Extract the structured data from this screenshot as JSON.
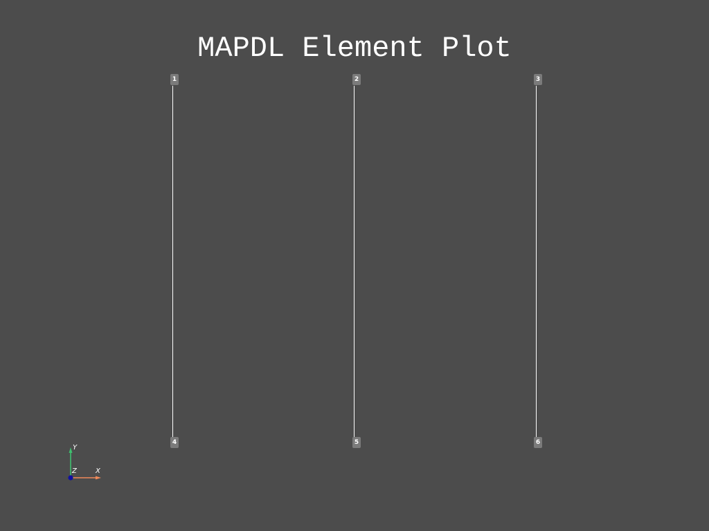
{
  "title": "MAPDL Element Plot",
  "colors": {
    "background": "#4c4c4c",
    "element_line": "#ffffff",
    "node_label_bg": "#7b7b7b",
    "axis_x": "#f08a5a",
    "axis_y": "#3fbf6f",
    "axis_z": "#1010a0"
  },
  "nodes": [
    {
      "label": "1"
    },
    {
      "label": "2"
    },
    {
      "label": "3"
    },
    {
      "label": "4"
    },
    {
      "label": "5"
    },
    {
      "label": "6"
    }
  ],
  "elements": [
    {
      "from": "1",
      "to": "4"
    },
    {
      "from": "2",
      "to": "5"
    },
    {
      "from": "3",
      "to": "6"
    }
  ],
  "axes": {
    "x_label": "X",
    "y_label": "Y",
    "z_label": "Z"
  }
}
